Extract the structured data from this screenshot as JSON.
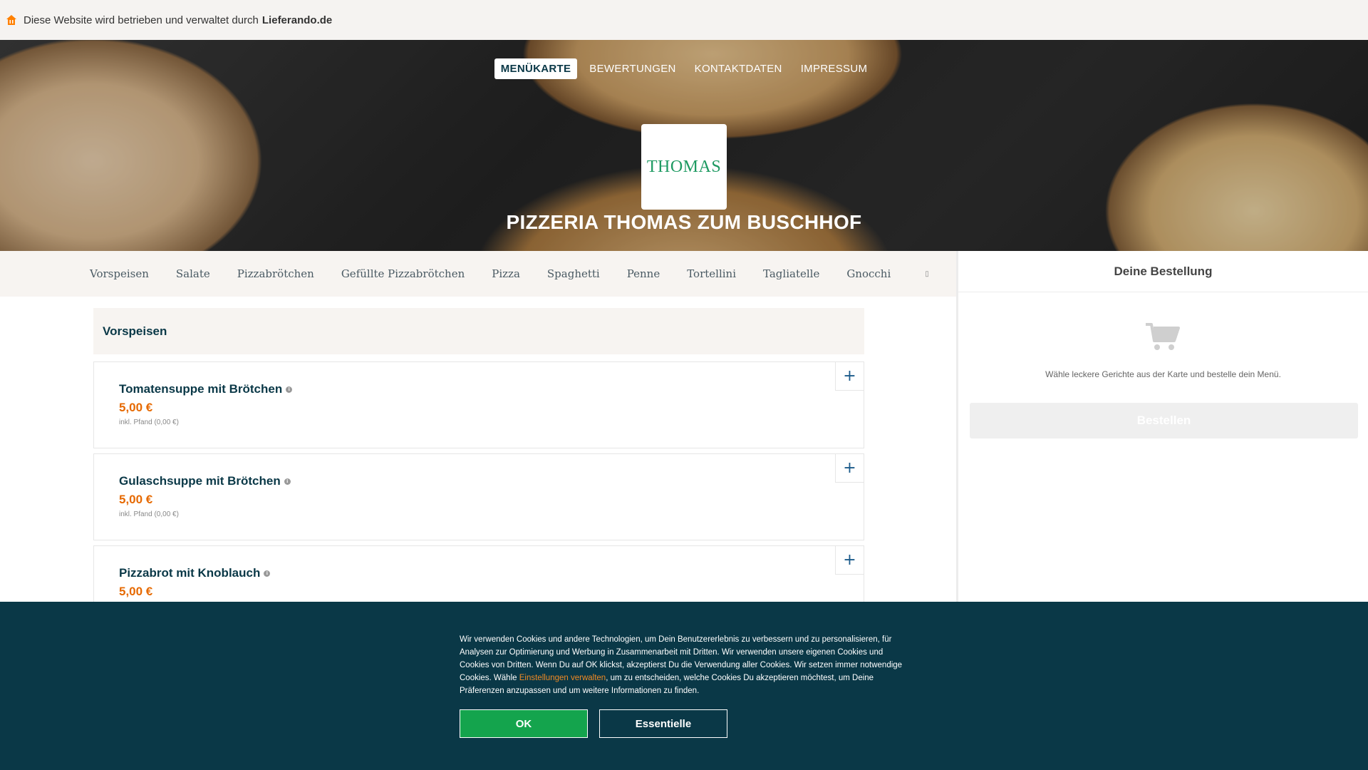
{
  "topbar": {
    "text": "Diese Website wird betrieben und verwaltet durch",
    "brand": "Lieferando.de",
    "icon": "home-icon",
    "brand_color": "#ff8000"
  },
  "hero": {
    "nav": [
      "MENÜKARTE",
      "BEWERTUNGEN",
      "KONTAKTDATEN",
      "IMPRESSUM"
    ],
    "active_nav": "MENÜKARTE",
    "logo_text": "THOMAS",
    "restaurant_name": "PIZZERIA THOMAS ZUM BUSCHHOF"
  },
  "categories": [
    "Vorspeisen",
    "Salate",
    "Pizzabrötchen",
    "Gefüllte Pizzabrötchen",
    "Pizza",
    "Spaghetti",
    "Penne",
    "Tortellini",
    "Tagliatelle",
    "Gnocchi"
  ],
  "menu": {
    "section_title": "Vorspeisen",
    "dishes": [
      {
        "name": "Tomatensuppe mit Brötchen",
        "price": "5,00 €",
        "deposit": "inkl. Pfand (0,00 €)"
      },
      {
        "name": "Gulaschsuppe mit Brötchen",
        "price": "5,00 €",
        "deposit": "inkl. Pfand (0,00 €)"
      },
      {
        "name": "Pizzabrot mit Knoblauch",
        "price": "5,00 €",
        "deposit": ""
      }
    ],
    "add_label": "+"
  },
  "basket": {
    "title": "Deine Bestellung",
    "empty_text": "Wähle leckere Gerichte aus der Karte und bestelle dein Menü.",
    "order_button": "Bestellen"
  },
  "cookie": {
    "text_before": "Wir verwenden Cookies und andere Technologien, um Dein Benutzererlebnis zu verbessern und zu personalisieren, für Analysen zur Optimierung und Werbung in Zusammenarbeit mit Dritten. Wir verwenden unsere eigenen Cookies und Cookies von Dritten. Wenn Du auf OK klickst, akzeptierst Du die Verwendung aller Cookies. Wir setzen immer notwendige Cookies. Wähle ",
    "link": "Einstellungen verwalten",
    "text_after": ", um zu entscheiden, welche Cookies Du akzeptieren möchtest, um Deine Präferenzen anzupassen und um weitere Informationen zu finden.",
    "ok_button": "OK",
    "essential_button": "Essentielle"
  }
}
